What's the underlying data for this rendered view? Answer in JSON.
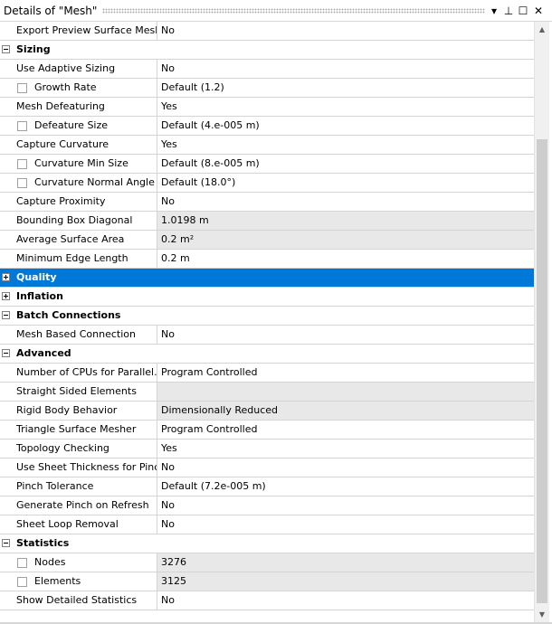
{
  "panel": {
    "title": "Details of \"Mesh\"",
    "buttons": {
      "dropdown": "▾",
      "pin": "⊥",
      "maximize": "☐",
      "close": "✕"
    }
  },
  "rows": [
    {
      "type": "prop",
      "label": "Export Preview Surface Mesh",
      "value": "No"
    },
    {
      "type": "group",
      "label": "Sizing",
      "expanded": true
    },
    {
      "type": "prop",
      "label": "Use Adaptive Sizing",
      "value": "No"
    },
    {
      "type": "prop",
      "label": "Growth Rate",
      "value": "Default (1.2)",
      "checkbox": true
    },
    {
      "type": "prop",
      "label": "Mesh Defeaturing",
      "value": "Yes"
    },
    {
      "type": "prop",
      "label": "Defeature Size",
      "value": "Default (4.e-005 m)",
      "checkbox": true
    },
    {
      "type": "prop",
      "label": "Capture Curvature",
      "value": "Yes"
    },
    {
      "type": "prop",
      "label": "Curvature Min Size",
      "value": "Default (8.e-005 m)",
      "checkbox": true
    },
    {
      "type": "prop",
      "label": "Curvature Normal Angle",
      "value": "Default (18.0°)",
      "checkbox": true
    },
    {
      "type": "prop",
      "label": "Capture Proximity",
      "value": "No"
    },
    {
      "type": "prop",
      "label": "Bounding Box Diagonal",
      "value": "1.0198 m",
      "readonly": true
    },
    {
      "type": "prop",
      "label": "Average Surface Area",
      "value": "0.2 m²",
      "readonly": true
    },
    {
      "type": "prop",
      "label": "Minimum Edge Length",
      "value": "0.2 m"
    },
    {
      "type": "group",
      "label": "Quality",
      "expanded": false,
      "selected": true
    },
    {
      "type": "group",
      "label": "Inflation",
      "expanded": false
    },
    {
      "type": "group",
      "label": "Batch Connections",
      "expanded": true
    },
    {
      "type": "prop",
      "label": "Mesh Based Connection",
      "value": "No"
    },
    {
      "type": "group",
      "label": "Advanced",
      "expanded": true
    },
    {
      "type": "prop",
      "label": "Number of CPUs for Parallel...",
      "value": "Program Controlled"
    },
    {
      "type": "prop",
      "label": "Straight Sided Elements",
      "value": "",
      "readonly": true
    },
    {
      "type": "prop",
      "label": "Rigid Body Behavior",
      "value": "Dimensionally Reduced",
      "readonly": true
    },
    {
      "type": "prop",
      "label": "Triangle Surface Mesher",
      "value": "Program Controlled"
    },
    {
      "type": "prop",
      "label": "Topology Checking",
      "value": "Yes"
    },
    {
      "type": "prop",
      "label": "Use Sheet Thickness for Pinch",
      "value": "No"
    },
    {
      "type": "prop",
      "label": "Pinch Tolerance",
      "value": "Default (7.2e-005 m)"
    },
    {
      "type": "prop",
      "label": "Generate Pinch on Refresh",
      "value": "No"
    },
    {
      "type": "prop",
      "label": "Sheet Loop Removal",
      "value": "No"
    },
    {
      "type": "group",
      "label": "Statistics",
      "expanded": true
    },
    {
      "type": "prop",
      "label": "Nodes",
      "value": "3276",
      "checkbox": true,
      "readonly": true
    },
    {
      "type": "prop",
      "label": "Elements",
      "value": "3125",
      "checkbox": true,
      "readonly": true
    },
    {
      "type": "prop",
      "label": "Show Detailed Statistics",
      "value": "No"
    }
  ],
  "scrollbar": {
    "up_arrow": "▲",
    "down_arrow": "▼"
  },
  "colors": {
    "selection": "#0078d7",
    "readonly_bg": "#e8e8e8",
    "grid_line": "#d4d4d4"
  }
}
